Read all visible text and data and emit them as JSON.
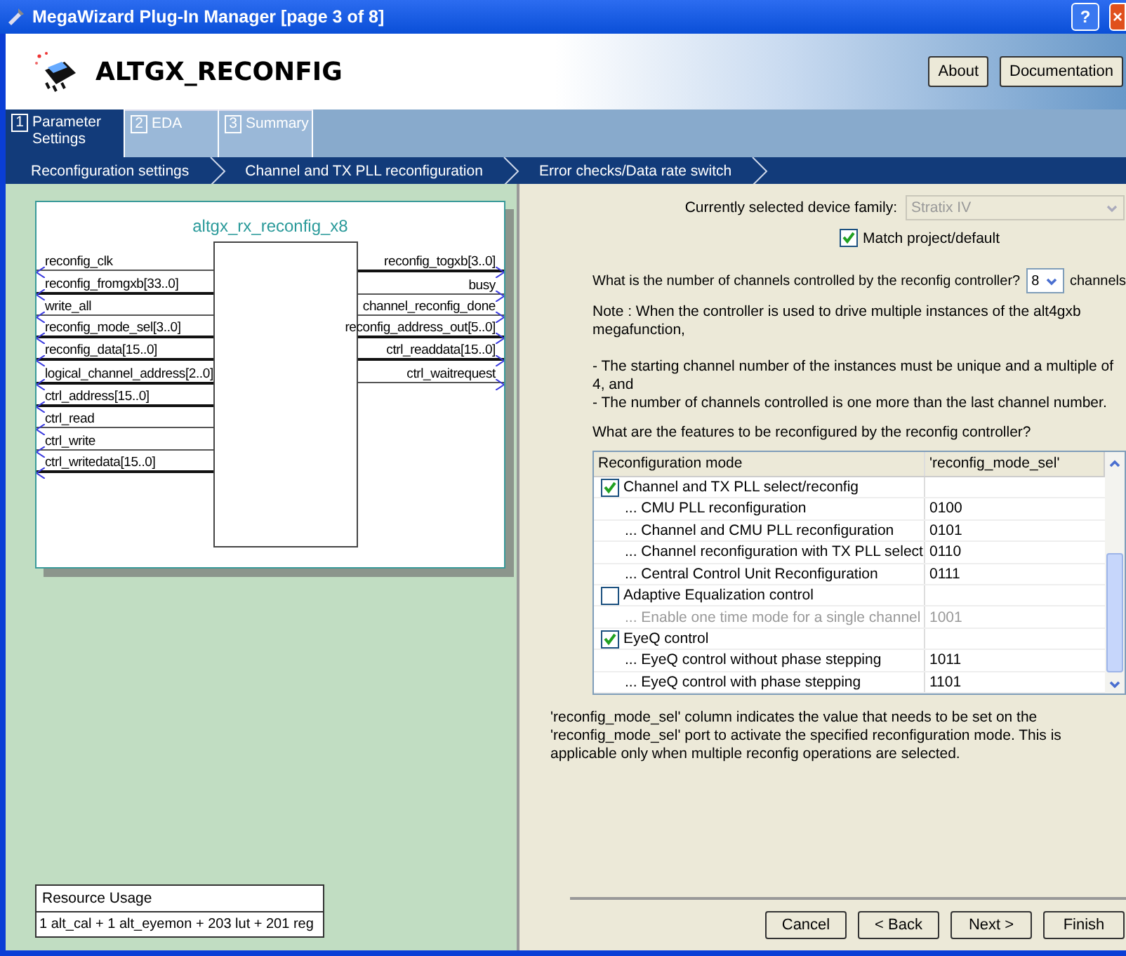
{
  "window": {
    "title": "MegaWizard Plug-In Manager [page 3 of 8]",
    "help_button": "?",
    "close_button": "×"
  },
  "header": {
    "title": "ALTGX_RECONFIG",
    "buttons": [
      "About",
      "Documentation"
    ]
  },
  "tabs": [
    {
      "number": "1",
      "label": "Parameter Settings",
      "selected": true
    },
    {
      "number": "2",
      "label": "EDA",
      "selected": false
    },
    {
      "number": "3",
      "label": "Summary",
      "selected": false
    }
  ],
  "breadcrumbs": [
    {
      "label": "Reconfiguration settings"
    },
    {
      "label": "Channel and TX PLL reconfiguration"
    },
    {
      "label": "Error checks/Data rate switch"
    }
  ],
  "diagram": {
    "title": "altgx_rx_reconfig_x8",
    "inputs": [
      {
        "name": "reconfig_clk",
        "bus": false
      },
      {
        "name": "reconfig_fromgxb[33..0]",
        "bus": true
      },
      {
        "name": "write_all",
        "bus": false
      },
      {
        "name": "reconfig_mode_sel[3..0]",
        "bus": true
      },
      {
        "name": "reconfig_data[15..0]",
        "bus": true
      },
      {
        "name": "logical_channel_address[2..0]",
        "bus": true
      },
      {
        "name": "ctrl_address[15..0]",
        "bus": true
      },
      {
        "name": "ctrl_read",
        "bus": false
      },
      {
        "name": "ctrl_write",
        "bus": false
      },
      {
        "name": "ctrl_writedata[15..0]",
        "bus": true
      }
    ],
    "outputs": [
      {
        "name": "reconfig_togxb[3..0]",
        "bus": true
      },
      {
        "name": "busy",
        "bus": false
      },
      {
        "name": "channel_reconfig_done",
        "bus": false
      },
      {
        "name": "reconfig_address_out[5..0]",
        "bus": true
      },
      {
        "name": "ctrl_readdata[15..0]",
        "bus": true
      },
      {
        "name": "ctrl_waitrequest",
        "bus": false
      }
    ]
  },
  "resource_usage": {
    "title": "Resource Usage",
    "value": "1 alt_cal + 1 alt_eyemon + 203 lut + 201 reg"
  },
  "device_family": {
    "label": "Currently selected device family:",
    "value": "Stratix IV",
    "disabled": true
  },
  "match_project": {
    "label": "Match project/default",
    "checked": true
  },
  "channels": {
    "question": "What is the number of channels controlled by the reconfig controller?",
    "value": "8",
    "unit": "channels"
  },
  "note": "Note : When the controller is used to drive multiple instances of the alt4gxb megafunction,",
  "bullets": [
    "- The starting channel number of the instances must be unique and a multiple of 4, and",
    "- The number of channels controlled is one more than the last channel number."
  ],
  "features_question": "What are the features to be reconfigured by the reconfig controller?",
  "table": {
    "columns": [
      "Reconfiguration mode",
      "'reconfig_mode_sel'"
    ],
    "rows": [
      {
        "label": "Channel and TX PLL select/reconfig",
        "checked": true,
        "children": [
          {
            "label": "... CMU PLL reconfiguration",
            "value": "0100",
            "disabled": false
          },
          {
            "label": "... Channel and CMU PLL reconfiguration",
            "value": "0101",
            "disabled": false
          },
          {
            "label": "... Channel reconfiguration with TX PLL select",
            "value": "0110",
            "disabled": false
          },
          {
            "label": "... Central Control Unit Reconfiguration",
            "value": "0111",
            "disabled": false
          }
        ]
      },
      {
        "label": "Adaptive Equalization control",
        "checked": false,
        "children": [
          {
            "label": "... Enable one time mode for a single channel",
            "value": "1001",
            "disabled": true
          }
        ]
      },
      {
        "label": "EyeQ control",
        "checked": true,
        "children": [
          {
            "label": "... EyeQ control without phase stepping",
            "value": "1011",
            "disabled": false
          },
          {
            "label": "... EyeQ control with phase stepping",
            "value": "1101",
            "disabled": false
          }
        ]
      }
    ]
  },
  "footnote": "'reconfig_mode_sel' column indicates the value that needs to be set on the 'reconfig_mode_sel' port to activate the specified reconfiguration mode. This is applicable only when multiple reconfig operations are selected.",
  "buttons": [
    {
      "label": "Cancel",
      "disabled": false
    },
    {
      "label": "< Back",
      "disabled": false
    },
    {
      "label": "Next >",
      "disabled": false
    },
    {
      "label": "Finish",
      "disabled": false
    }
  ]
}
